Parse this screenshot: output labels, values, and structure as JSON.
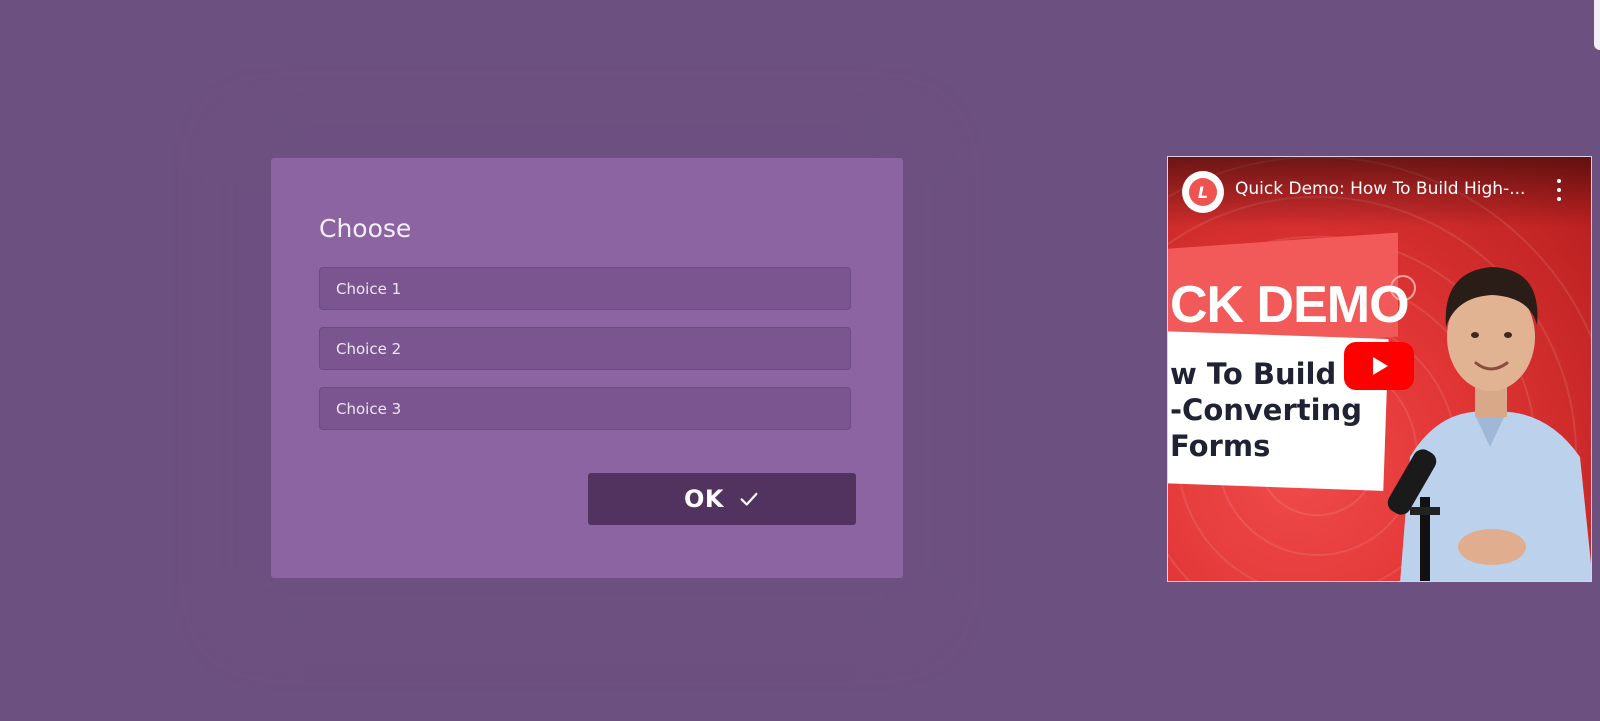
{
  "form": {
    "title": "Choose",
    "choices": [
      {
        "label": "Choice 1"
      },
      {
        "label": "Choice 2"
      },
      {
        "label": "Choice 3"
      }
    ],
    "ok_label": "OK",
    "ok_icon": "checkmark-icon"
  },
  "video": {
    "title": "Quick Demo: How To Build High-...",
    "channel_initial": "L",
    "thumbnail": {
      "heading": "CK DEMO",
      "lines": [
        "w To Build",
        "-Converting",
        " Forms"
      ]
    },
    "icons": [
      "channel-avatar",
      "more-vert-icon",
      "play-icon"
    ]
  },
  "colors": {
    "background": "#6c507f",
    "card": "#8c64a2",
    "choice": "#7b5590",
    "ok_button": "#52335f",
    "youtube_red": "#ff0000"
  }
}
